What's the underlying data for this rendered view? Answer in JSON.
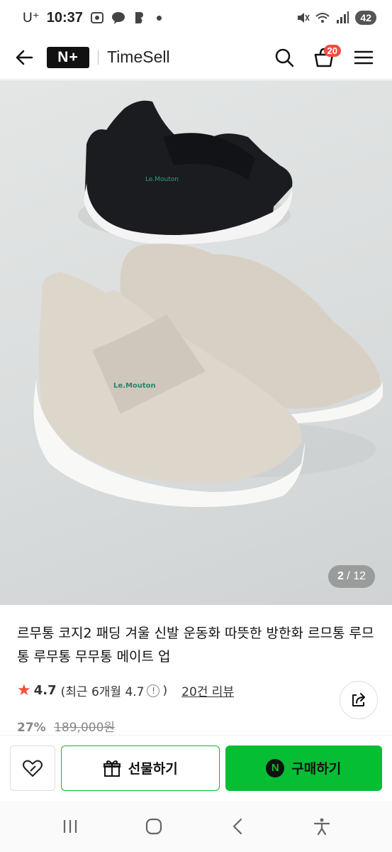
{
  "status": {
    "carrier": "U⁺",
    "time": "10:37",
    "battery": "42"
  },
  "topbar": {
    "logo": "N+",
    "brand": "TimeSell",
    "cart_count": "20"
  },
  "gallery": {
    "current": "2",
    "separator": " / ",
    "total": "12"
  },
  "product": {
    "title": "르무통 코지2 패딩 겨울 신발 운동화 따뜻한 방한화 르므통 루므통 루무통 무무통 메이트 업",
    "rating": "4.7",
    "rating_recent": "(최근 6개월 4.7",
    "rating_close": ")",
    "reviews": "20건 리뷰",
    "discount": "27%",
    "original_price": "189,000원"
  },
  "actions": {
    "gift_label": "선물하기",
    "buy_label": "구매하기",
    "npay_mark": "N"
  },
  "colors": {
    "accent": "#06be34",
    "badge": "#f04e3e"
  }
}
